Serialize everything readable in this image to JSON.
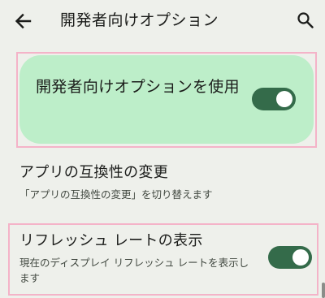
{
  "app_bar": {
    "title": "開発者向けオプション",
    "back_icon": "arrow-back-icon",
    "search_icon": "search-icon"
  },
  "main_switch": {
    "label": "開発者向けオプションを使用",
    "checked": true,
    "background_color": "#bdeec9",
    "toggle_color": "#346b4a"
  },
  "settings": [
    {
      "title": "アプリの互換性の変更",
      "summary": "「アプリの互換性の変更」を切り替えます"
    },
    {
      "title": "リフレッシュ レートの表示",
      "summary": "現在のディスプレイ リフレッシュ レートを表示します",
      "checked": true
    }
  ],
  "colors": {
    "background": "#eef0eb",
    "highlight_border": "#f4b3c8",
    "accent": "#346b4a"
  }
}
